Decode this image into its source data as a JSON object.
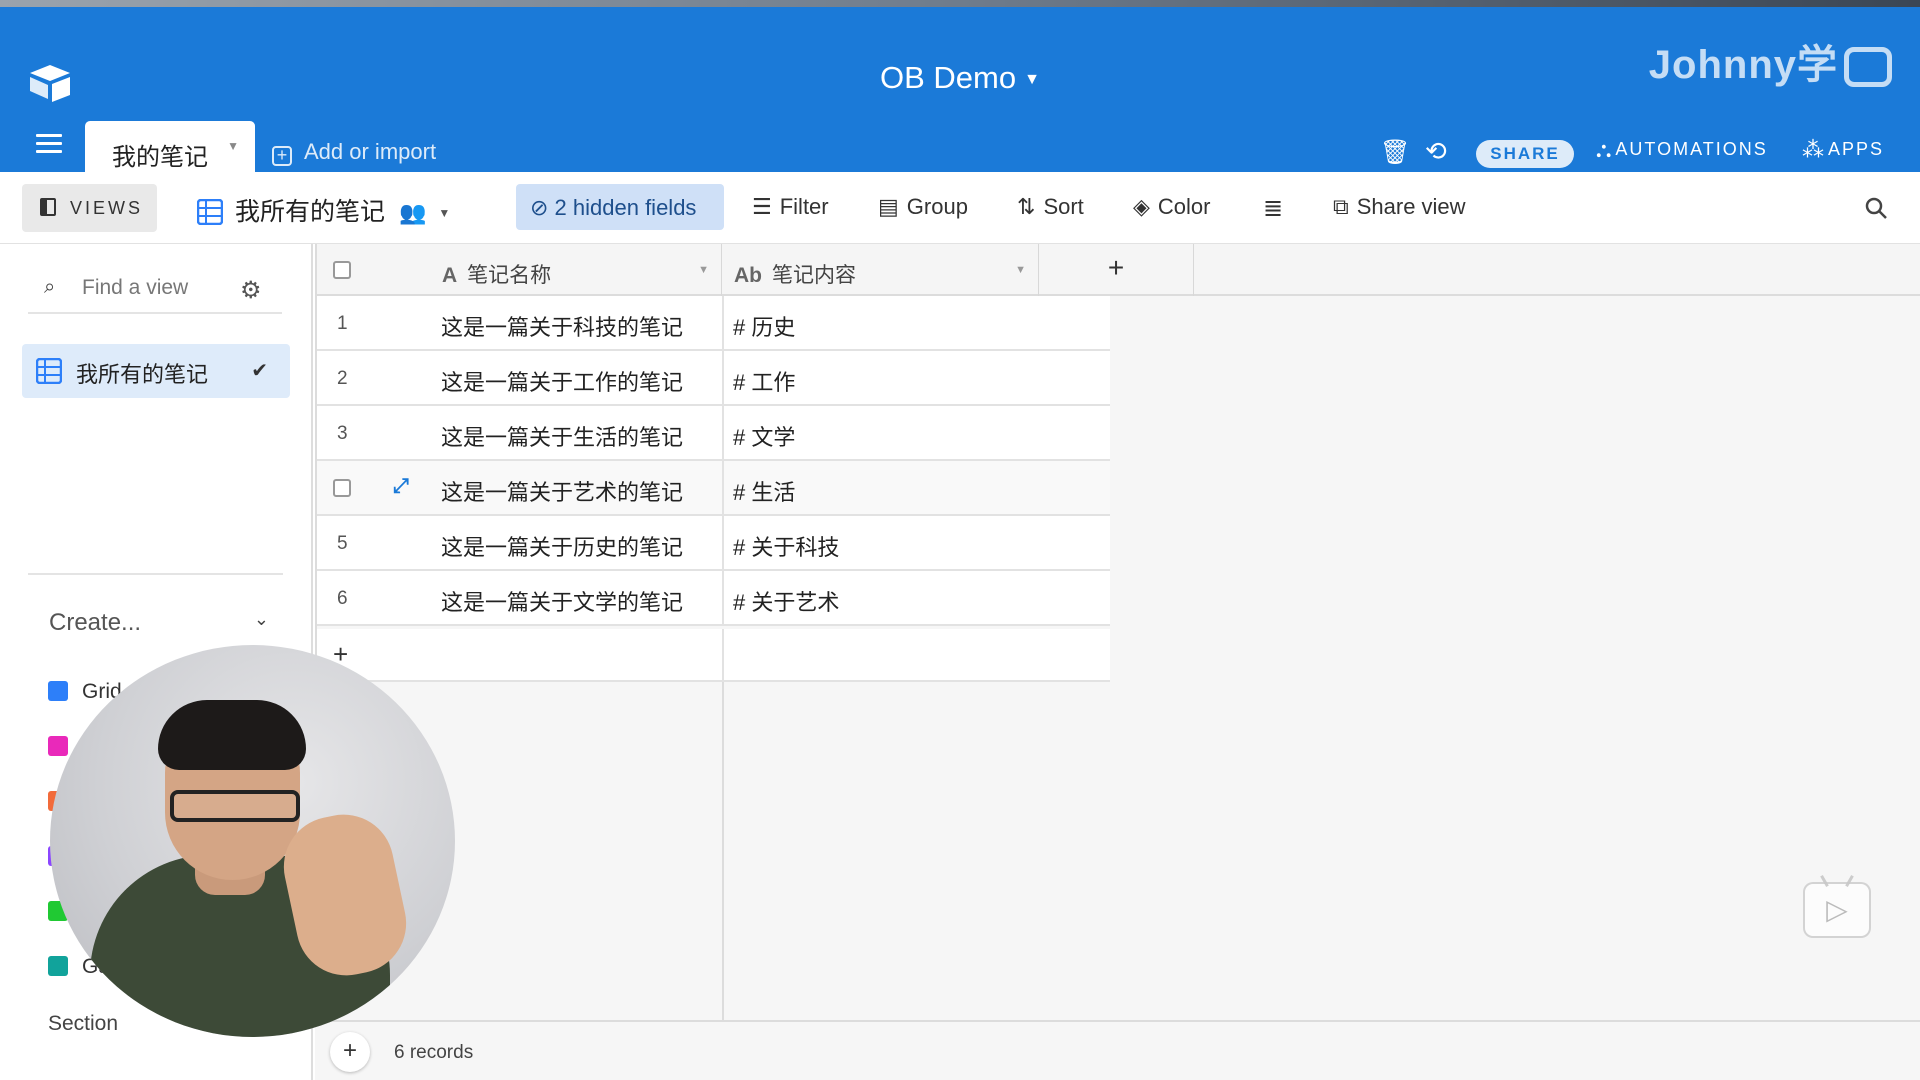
{
  "header": {
    "base_title": "OB Demo",
    "watermark": "Johnny学",
    "table_tab": "我的笔记",
    "add_import": "Add or import",
    "share": "SHARE",
    "automations": "AUTOMATIONS",
    "apps": "APPS"
  },
  "viewbar": {
    "views": "VIEWS",
    "current_view": "我所有的笔记",
    "hidden_fields": "2 hidden fields",
    "filter": "Filter",
    "group": "Group",
    "sort": "Sort",
    "color": "Color",
    "share_view": "Share view"
  },
  "sidebar": {
    "find_placeholder": "Find a view",
    "view_item": "我所有的笔记",
    "create": "Create...",
    "create_items": [
      {
        "label": "Grid",
        "color": "#2d7ff9"
      },
      {
        "label": "",
        "color": "#e929ba"
      },
      {
        "label": "",
        "color": "#f26b3a"
      },
      {
        "label": "",
        "color": "#8b46ff"
      },
      {
        "label": "",
        "color": "#20c933"
      },
      {
        "label": "Ga",
        "color": "#11a39b"
      }
    ],
    "section": "Section"
  },
  "grid": {
    "columns": [
      {
        "name": "笔记名称",
        "type_icon": "A"
      },
      {
        "name": "笔记内容",
        "type_icon": "Ab"
      }
    ],
    "rows": [
      {
        "num": "1",
        "name": "这是一篇关于科技的笔记",
        "content": "# 历史"
      },
      {
        "num": "2",
        "name": "这是一篇关于工作的笔记",
        "content": "# 工作"
      },
      {
        "num": "3",
        "name": "这是一篇关于生活的笔记",
        "content": "# 文学"
      },
      {
        "num": "",
        "name": "这是一篇关于艺术的笔记",
        "content": "# 生活"
      },
      {
        "num": "5",
        "name": "这是一篇关于历史的笔记",
        "content": "# 关于科技"
      },
      {
        "num": "6",
        "name": "这是一篇关于文学的笔记",
        "content": "# 关于艺术"
      }
    ],
    "record_count": "6 records"
  },
  "colors": {
    "header_bg": "#1b7ad8",
    "hidden_fields_bg": "#cfe0f7",
    "selected_view_bg": "#deebfa"
  }
}
